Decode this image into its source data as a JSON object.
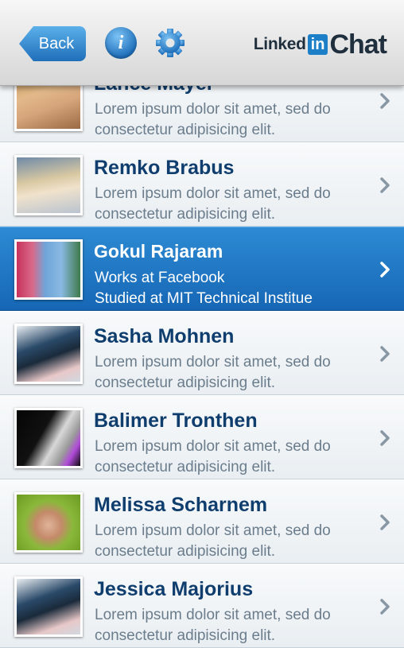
{
  "header": {
    "back_label": "Back",
    "info_glyph": "i",
    "logo": {
      "part1": "Linked",
      "badge": "in",
      "part2": "Chat"
    }
  },
  "contacts": [
    {
      "name": "Lance Mayer",
      "line1": "Lorem ipsum dolor sit amet, sed do",
      "line2": "consectetur adipisicing elit.",
      "selected": false
    },
    {
      "name": "Remko Brabus",
      "line1": "Lorem ipsum dolor sit amet, sed do",
      "line2": "consectetur adipisicing elit.",
      "selected": false
    },
    {
      "name": "Gokul Rajaram",
      "line1": "Works at Facebook",
      "line2": "Studied at MIT Technical Institue",
      "selected": true
    },
    {
      "name": "Sasha Mohnen",
      "line1": "Lorem ipsum dolor sit amet, sed do",
      "line2": "consectetur adipisicing elit.",
      "selected": false
    },
    {
      "name": "Balimer Tronthen",
      "line1": "Lorem ipsum dolor sit amet, sed do",
      "line2": "consectetur adipisicing elit.",
      "selected": false
    },
    {
      "name": "Melissa Scharnem",
      "line1": "Lorem ipsum dolor sit amet, sed do",
      "line2": "consectetur adipisicing elit.",
      "selected": false
    },
    {
      "name": "Jessica Majorius",
      "line1": "Lorem ipsum dolor sit amet, sed do",
      "line2": "consectetur adipisicing elit.",
      "selected": false
    }
  ],
  "colors": {
    "accent": "#1f6fba",
    "name_text": "#0f3e6e",
    "sub_text": "#6b7d8c",
    "selected_row": "#1a72bf"
  },
  "icons": {
    "back": "back-arrow-button",
    "info": "info-icon",
    "settings": "gear-icon",
    "row_arrow": "chevron-right-icon"
  }
}
